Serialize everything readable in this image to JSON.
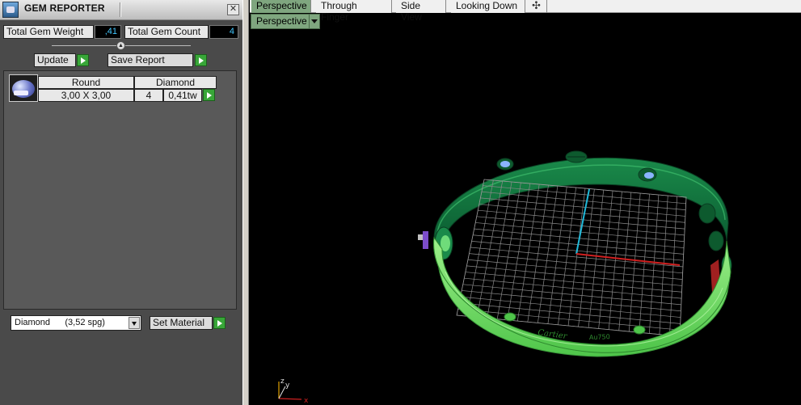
{
  "reporter": {
    "title": "GEM REPORTER",
    "close_glyph": "✕",
    "total_weight_label": "Total Gem Weight",
    "total_weight_value": ",41",
    "total_count_label": "Total Gem Count",
    "total_count_value": "4",
    "update_label": "Update",
    "save_label": "Save Report",
    "gems": [
      {
        "shape": "Round",
        "material": "Diamond",
        "size": "3,00 X 3,00",
        "count": "4",
        "weight": "0,41tw"
      }
    ],
    "material_select": "Diamond      (3,52 spg)",
    "set_material_label": "Set Material"
  },
  "viewport": {
    "tabs": [
      "Perspective",
      "Through Finger",
      "Side View",
      "Looking Down"
    ],
    "active_tab": "Perspective",
    "add_tab_glyph": "✣",
    "view_mode": "Perspective",
    "engraving": "Cartier",
    "hallmark": "Au750",
    "axis_labels": {
      "x": "x",
      "y": "y",
      "z": "z"
    }
  },
  "colors": {
    "ring_dark": "#0d6b3a",
    "ring_light": "#7de86b",
    "gem_blue": "#8ab4ff",
    "grid": "#8a8a8a",
    "axis_red": "#d02020",
    "axis_cyan": "#20b8d8",
    "go_green": "#38a638",
    "tab_active": "#7fa67f"
  }
}
